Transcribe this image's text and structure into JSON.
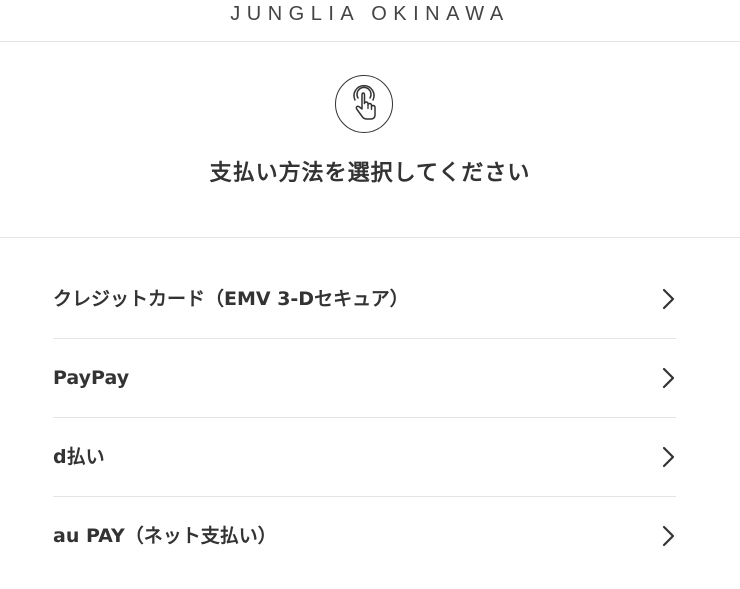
{
  "header": {
    "brand": "JUNGLIA OKINAWA"
  },
  "hero": {
    "icon": "tap-hand-icon",
    "title": "支払い方法を選択してください"
  },
  "payment_methods": [
    {
      "label": "クレジットカード（EMV 3-Dセキュア）",
      "icon": "chevron-right-icon"
    },
    {
      "label": "PayPay",
      "icon": "chevron-right-icon"
    },
    {
      "label": "d払い",
      "icon": "chevron-right-icon"
    },
    {
      "label": "au PAY（ネット支払い）",
      "icon": "chevron-right-icon"
    }
  ],
  "colors": {
    "text": "#333333",
    "divider": "#e4e4e4",
    "background": "#ffffff"
  }
}
